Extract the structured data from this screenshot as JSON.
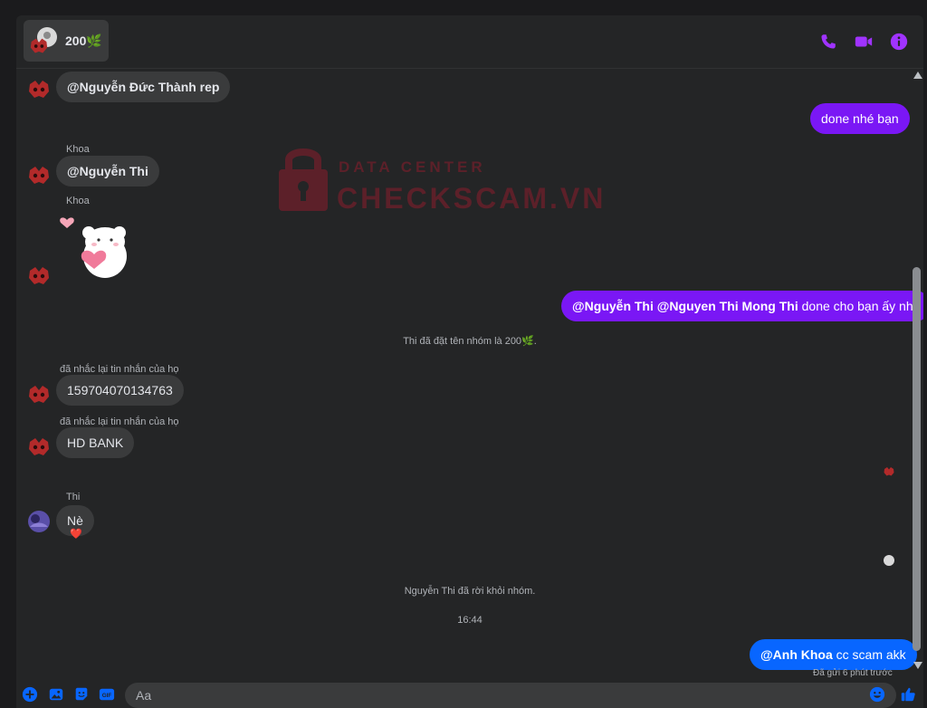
{
  "header": {
    "title": "200🌿",
    "icons": [
      "phone-icon",
      "video-camera-icon",
      "info-icon"
    ]
  },
  "watermark": {
    "line1": "DATA CENTER",
    "line2": "CHECKSCAM.VN"
  },
  "messages": {
    "m1": "@Nguyễn Đức Thành rep",
    "m2": "done nhé bạn",
    "m3_sender": "Khoa",
    "m3": "@Nguyễn Thi",
    "m4_sender": "Khoa",
    "m5_mention1": "@Nguyễn Thi",
    "m5_mention2": "@Nguyen Thi Mong Thi",
    "m5_text": "done cho bạn ấy nha",
    "system1": "Thi đã đặt tên nhóm là 200🌿.",
    "m6_sender": "đã nhắc lại tin nhắn của họ",
    "m6": "159704070134763",
    "m7_sender": "đã nhắc lại tin nhắn của họ",
    "m7": "HD BANK",
    "m8_sender": "Thi",
    "m8": "Nè",
    "m8_reaction": "❤️",
    "system2": "Nguyễn Thi đã rời khỏi nhóm.",
    "timestamp": "16:44",
    "m9_mention": "@Anh Khoa",
    "m9_text": "cc scam akk",
    "seen": "Đã gửi 6 phút trước"
  },
  "composer": {
    "placeholder": "Aa",
    "icons": [
      "plus-circle-icon",
      "image-icon",
      "sticker-icon",
      "gif-icon",
      "emoji-icon",
      "thumbs-up-icon"
    ]
  },
  "colors": {
    "outgoing_purple": "#7a17f5",
    "outgoing_blue": "#0866ff",
    "accent": "#a033ff",
    "incoming": "#3a3b3c"
  }
}
